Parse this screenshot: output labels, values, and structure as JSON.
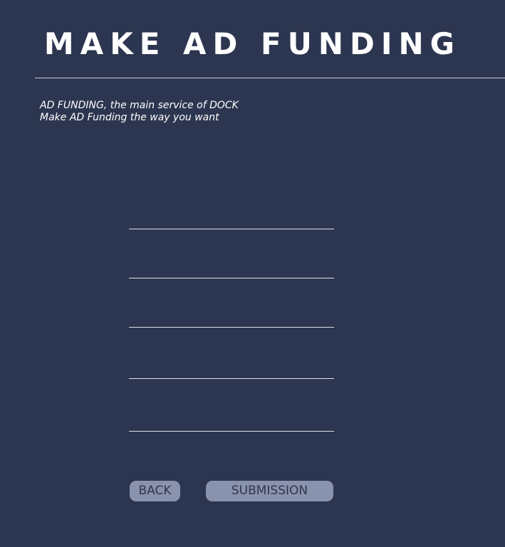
{
  "header": {
    "title": "MAKE AD FUNDING"
  },
  "intro": {
    "line1": "AD FUNDING, the main service of DOCK",
    "line2": "Make AD Funding the way you want"
  },
  "form": {
    "fields": [
      {
        "label": "",
        "value": ""
      },
      {
        "label": "",
        "value": ""
      },
      {
        "label": "",
        "value": ""
      },
      {
        "label": "",
        "value": ""
      },
      {
        "label": "",
        "value": ""
      }
    ]
  },
  "actions": {
    "back_label": "BACK",
    "submit_label": "SUBMISSION"
  },
  "colors": {
    "background": "#2d3650",
    "button_fill": "#8a93ad",
    "button_text": "#2d3650",
    "field_line": "#dfe2ea"
  }
}
